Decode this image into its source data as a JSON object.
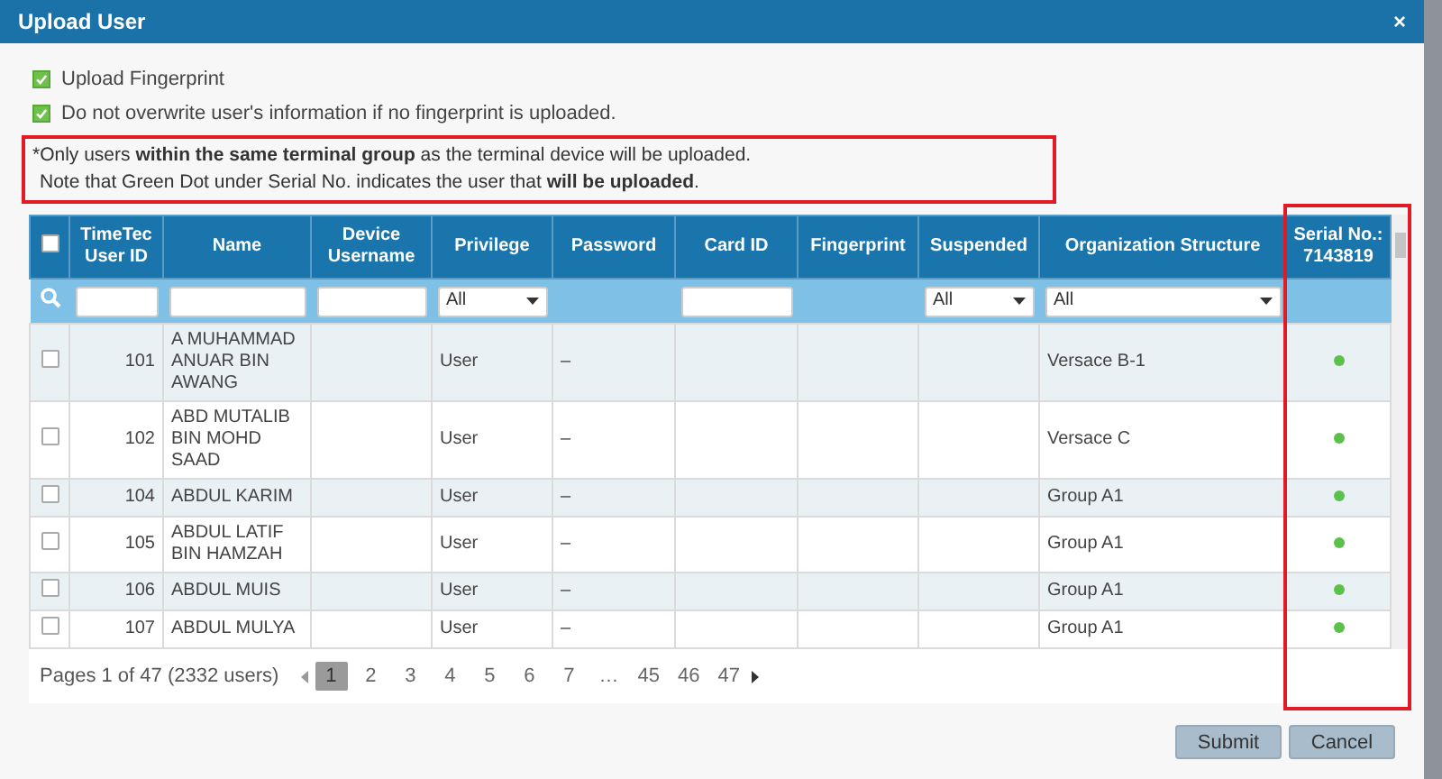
{
  "window": {
    "title": "Upload User",
    "close": "×"
  },
  "options": [
    {
      "label": "Upload Fingerprint",
      "checked": true
    },
    {
      "label": "Do not overwrite user's information if no fingerprint is uploaded.",
      "checked": true
    }
  ],
  "note": [
    "*Only users **within the same terminal group** as the terminal device will be uploaded.",
    "Note that Green Dot under Serial No. indicates the user that **will be uploaded**."
  ],
  "table": {
    "select_all": false,
    "columns": [
      {
        "label": "TimeTec User ID",
        "filter": {
          "kind": "text"
        }
      },
      {
        "label": "Name",
        "filter": {
          "kind": "text"
        }
      },
      {
        "label": "Device Username",
        "filter": {
          "kind": "text"
        }
      },
      {
        "label": "Privilege",
        "filter": {
          "kind": "select",
          "value": "All"
        }
      },
      {
        "label": "Password"
      },
      {
        "label": "Card ID",
        "filter": {
          "kind": "text"
        }
      },
      {
        "label": "Fingerprint"
      },
      {
        "label": "Suspended",
        "filter": {
          "kind": "select",
          "value": "All"
        }
      },
      {
        "label": "Organization Structure",
        "filter": {
          "kind": "select",
          "value": "All"
        }
      },
      {
        "label": "Serial No.: 7143819"
      }
    ],
    "rows": [
      {
        "selected": false,
        "id": "101",
        "name": "A MUHAMMAD ANUAR BIN AWANG",
        "privilege": "User",
        "password": "–",
        "organization": "Versace B-1",
        "uploaded": true
      },
      {
        "selected": false,
        "id": "102",
        "name": "ABD MUTALIB BIN MOHD SAAD",
        "privilege": "User",
        "password": "–",
        "organization": "Versace C",
        "uploaded": true
      },
      {
        "selected": false,
        "id": "104",
        "name": "ABDUL KARIM",
        "privilege": "User",
        "password": "–",
        "organization": "Group A1",
        "uploaded": true
      },
      {
        "selected": false,
        "id": "105",
        "name": "ABDUL LATIF BIN HAMZAH",
        "privilege": "User",
        "password": "–",
        "organization": "Group A1",
        "uploaded": true
      },
      {
        "selected": false,
        "id": "106",
        "name": "ABDUL MUIS",
        "privilege": "User",
        "password": "–",
        "organization": "Group A1",
        "uploaded": true
      },
      {
        "selected": false,
        "id": "107",
        "name": "ABDUL MULYA",
        "privilege": "User",
        "password": "–",
        "organization": "Group A1",
        "uploaded": true
      }
    ]
  },
  "pager": {
    "summary": "Pages 1 of 47 (2332 users)",
    "pages": [
      {
        "label": "1",
        "selected": true
      },
      {
        "label": "2",
        "selected": false
      },
      {
        "label": "3",
        "selected": false
      },
      {
        "label": "4",
        "selected": false
      },
      {
        "label": "5",
        "selected": false
      },
      {
        "label": "6",
        "selected": false
      },
      {
        "label": "7",
        "selected": false
      },
      {
        "label": "…",
        "selected": false
      },
      {
        "label": "45",
        "selected": false
      },
      {
        "label": "46",
        "selected": false
      },
      {
        "label": "47",
        "selected": false
      }
    ]
  },
  "buttons": [
    "Submit",
    "Cancel"
  ]
}
